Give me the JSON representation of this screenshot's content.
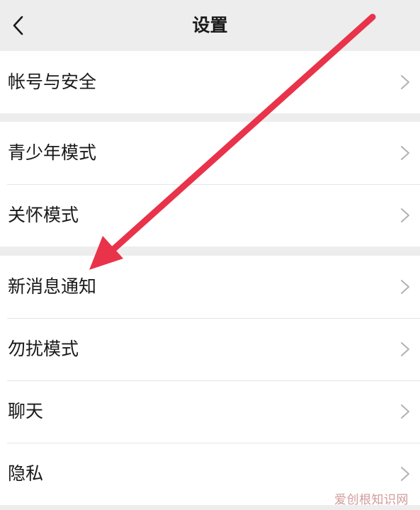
{
  "header": {
    "title": "设置",
    "back_icon": "chevron-left-icon"
  },
  "groups": [
    {
      "items": [
        {
          "label": "帐号与安全"
        }
      ]
    },
    {
      "items": [
        {
          "label": "青少年模式"
        },
        {
          "label": "关怀模式"
        }
      ]
    },
    {
      "items": [
        {
          "label": "新消息通知"
        },
        {
          "label": "勿扰模式"
        },
        {
          "label": "聊天"
        },
        {
          "label": "隐私"
        }
      ]
    }
  ],
  "annotation": {
    "arrow_color": "#e8334a"
  },
  "watermark": "爱创根知识网",
  "colors": {
    "background": "#ededed",
    "card": "#ffffff",
    "text": "#191919",
    "chevron": "#b2b2b2"
  }
}
